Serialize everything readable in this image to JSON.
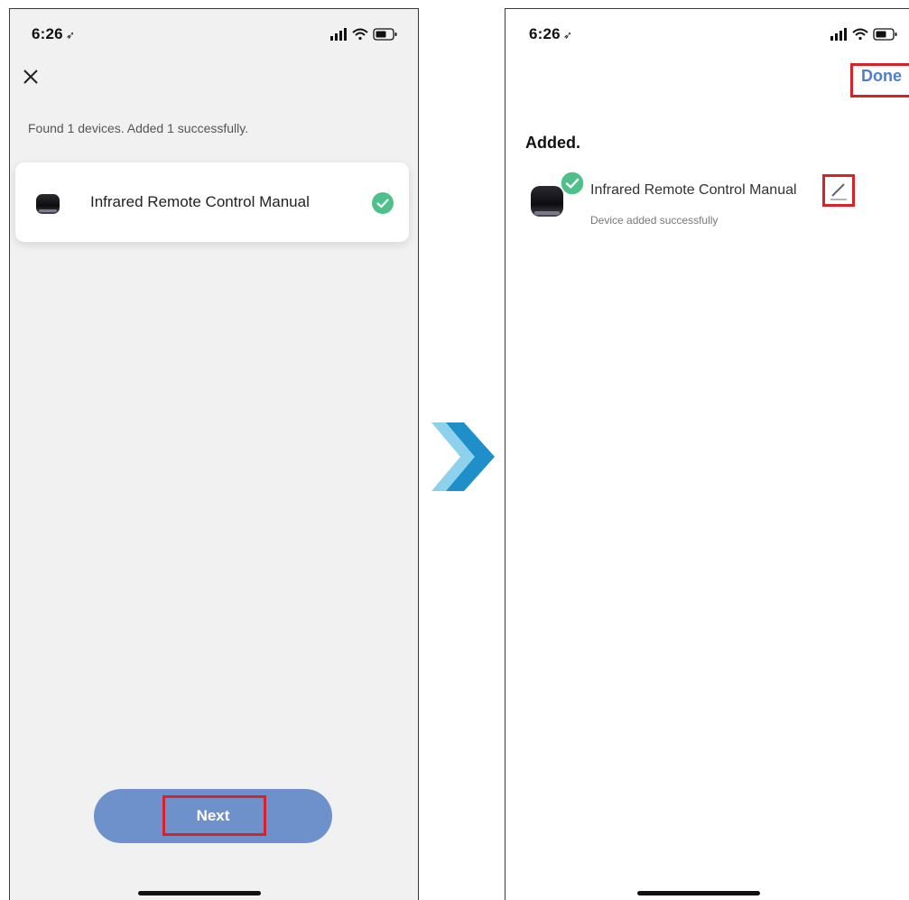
{
  "status_bar": {
    "time": "6:26",
    "location_glyph": "➶"
  },
  "left_screen": {
    "close_icon": "close-icon",
    "found_message": "Found 1 devices. Added 1 successfully.",
    "device": {
      "name": "Infrared Remote Control Manual",
      "status_icon": "check-circle-icon"
    },
    "next_label": "Next"
  },
  "right_screen": {
    "done_label": "Done",
    "heading": "Added.",
    "device": {
      "name": "Infrared Remote Control Manual",
      "subtitle": "Device added successfully",
      "edit_icon": "pencil-icon"
    }
  },
  "colors": {
    "accent_blue": "#4d7fcf",
    "button_blue": "#6e91cc",
    "success_green": "#4fc08b",
    "highlight_red": "#d8222a",
    "arrow_light": "#8dd1ec",
    "arrow_dark": "#1e8fc8"
  }
}
